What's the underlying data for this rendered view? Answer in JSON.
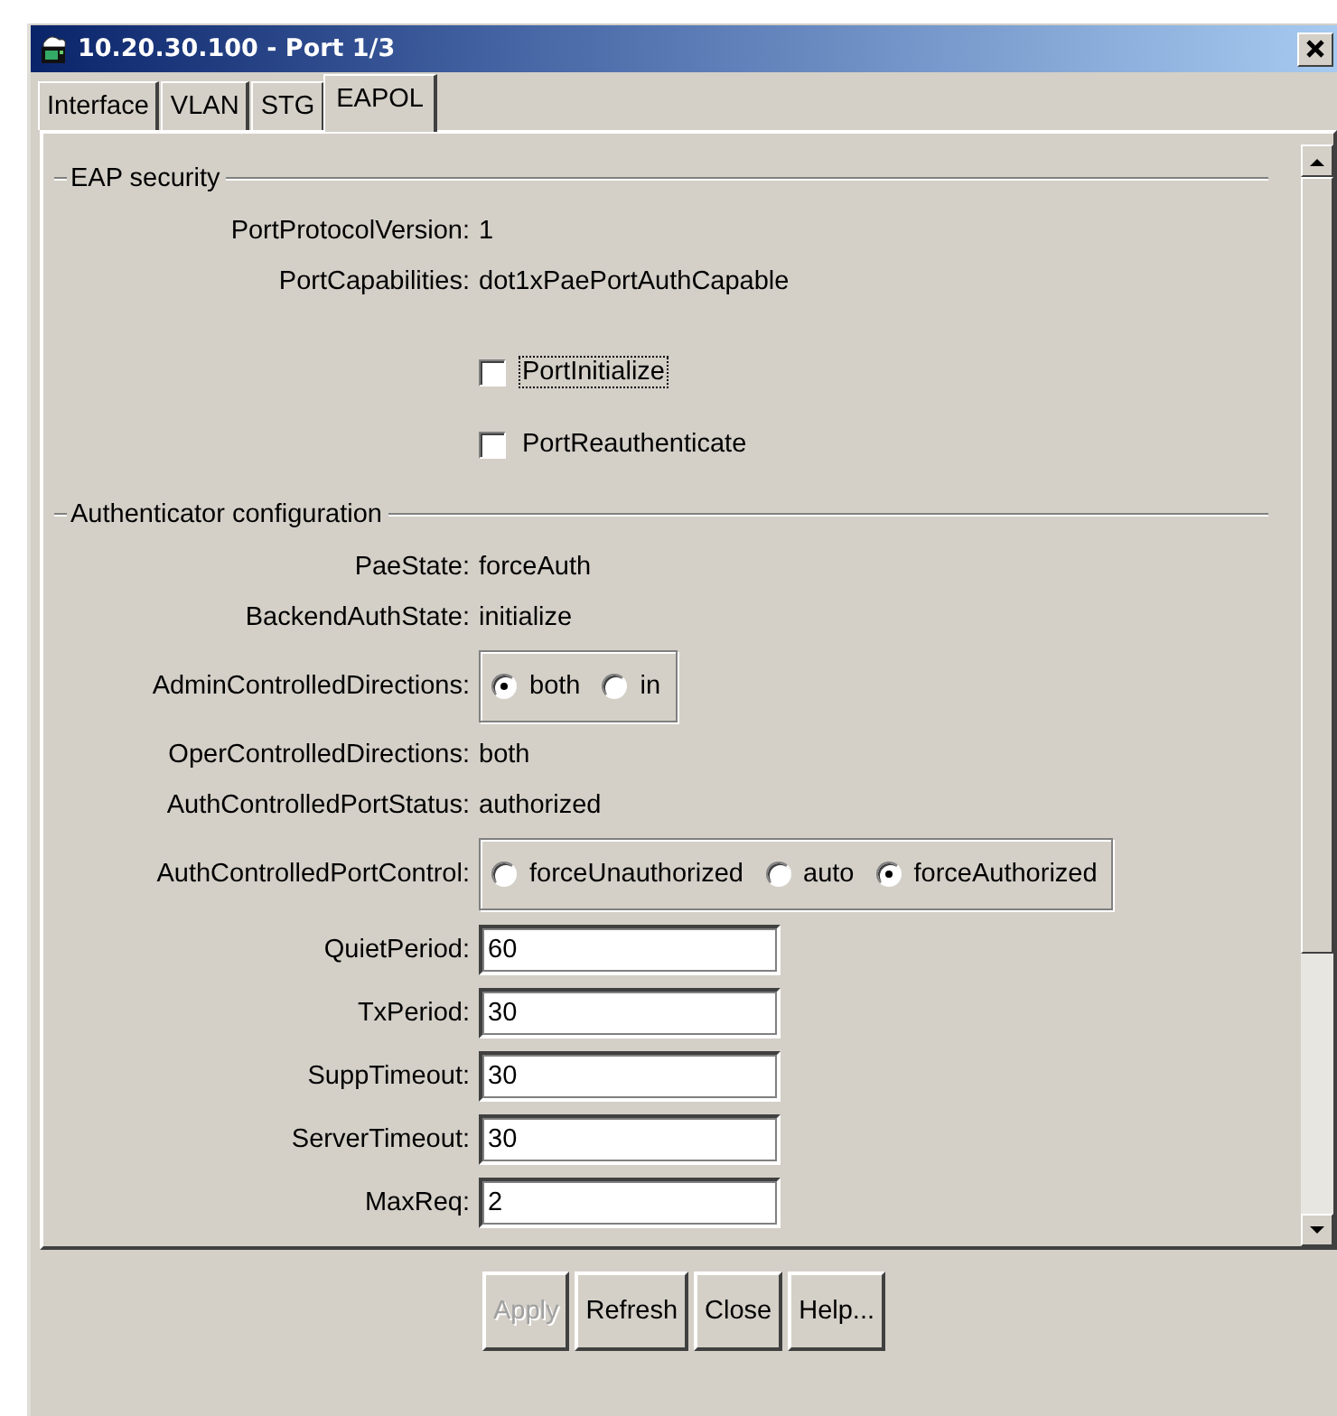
{
  "window": {
    "title": "10.20.30.100 - Port 1/3"
  },
  "tabs": [
    {
      "label": "Interface",
      "selected": false
    },
    {
      "label": "VLAN",
      "selected": false
    },
    {
      "label": "STG",
      "selected": false
    },
    {
      "label": "EAPOL",
      "selected": true
    }
  ],
  "sections": [
    {
      "title": "EAP security",
      "rows": [
        {
          "kind": "text",
          "label": "PortProtocolVersion:",
          "value": "1"
        },
        {
          "kind": "text",
          "label": "PortCapabilities:",
          "value": "dot1xPaePortAuthCapable"
        },
        {
          "kind": "checkbox",
          "label": "PortInitialize",
          "checked": false,
          "focused": true
        },
        {
          "kind": "checkbox",
          "label": "PortReauthenticate",
          "checked": false,
          "focused": false
        }
      ]
    },
    {
      "title": "Authenticator configuration",
      "rows": [
        {
          "kind": "text",
          "label": "PaeState:",
          "value": "forceAuth"
        },
        {
          "kind": "text",
          "label": "BackendAuthState:",
          "value": "initialize"
        },
        {
          "kind": "radio",
          "label": "AdminControlledDirections:",
          "options": [
            {
              "label": "both",
              "selected": true
            },
            {
              "label": "in",
              "selected": false
            }
          ]
        },
        {
          "kind": "text",
          "label": "OperControlledDirections:",
          "value": "both"
        },
        {
          "kind": "text",
          "label": "AuthControlledPortStatus:",
          "value": "authorized"
        },
        {
          "kind": "radio",
          "label": "AuthControlledPortControl:",
          "options": [
            {
              "label": "forceUnauthorized",
              "selected": false
            },
            {
              "label": "auto",
              "selected": false
            },
            {
              "label": "forceAuthorized",
              "selected": true
            }
          ]
        },
        {
          "kind": "field",
          "label": "QuietPeriod:",
          "value": "60"
        },
        {
          "kind": "field",
          "label": "TxPeriod:",
          "value": "30"
        },
        {
          "kind": "field",
          "label": "SuppTimeout:",
          "value": "30"
        },
        {
          "kind": "field",
          "label": "ServerTimeout:",
          "value": "30"
        },
        {
          "kind": "field",
          "label": "MaxReq:",
          "value": "2"
        }
      ]
    }
  ],
  "buttons": [
    {
      "label": "Apply",
      "disabled": true
    },
    {
      "label": "Refresh",
      "disabled": false
    },
    {
      "label": "Close",
      "disabled": false
    },
    {
      "label": "Help...",
      "disabled": false
    }
  ]
}
